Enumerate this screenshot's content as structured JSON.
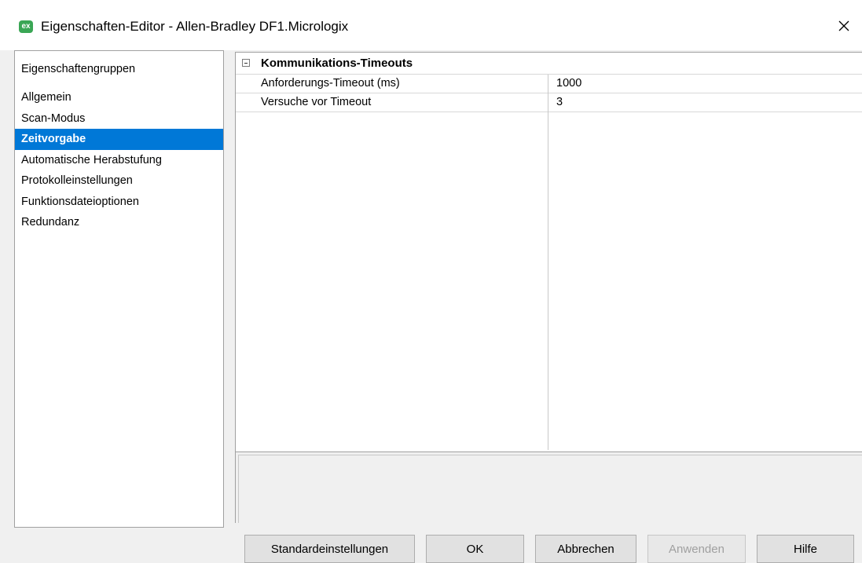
{
  "window": {
    "title": "Eigenschaften-Editor - Allen-Bradley DF1.Micrologix",
    "icon_text": "ex",
    "close_glyph": "✕"
  },
  "groups": {
    "heading": "Eigenschaftengruppen",
    "items": [
      {
        "label": "Allgemein"
      },
      {
        "label": "Scan-Modus"
      },
      {
        "label": "Zeitvorgabe",
        "selected": true
      },
      {
        "label": "Automatische Herabstufung"
      },
      {
        "label": "Protokolleinstellungen"
      },
      {
        "label": "Funktionsdateioptionen"
      },
      {
        "label": "Redundanz"
      }
    ]
  },
  "property_grid": {
    "category": "Kommunikations-Timeouts",
    "rows": [
      {
        "name": "Anforderungs-Timeout (ms)",
        "value": "1000"
      },
      {
        "name": "Versuche vor Timeout",
        "value": "3"
      }
    ]
  },
  "buttons": {
    "defaults": "Standardeinstellungen",
    "ok": "OK",
    "cancel": "Abbrechen",
    "apply": "Anwenden",
    "help": "Hilfe"
  },
  "colors": {
    "selection": "#0078d7",
    "app_icon": "#3aa655"
  }
}
